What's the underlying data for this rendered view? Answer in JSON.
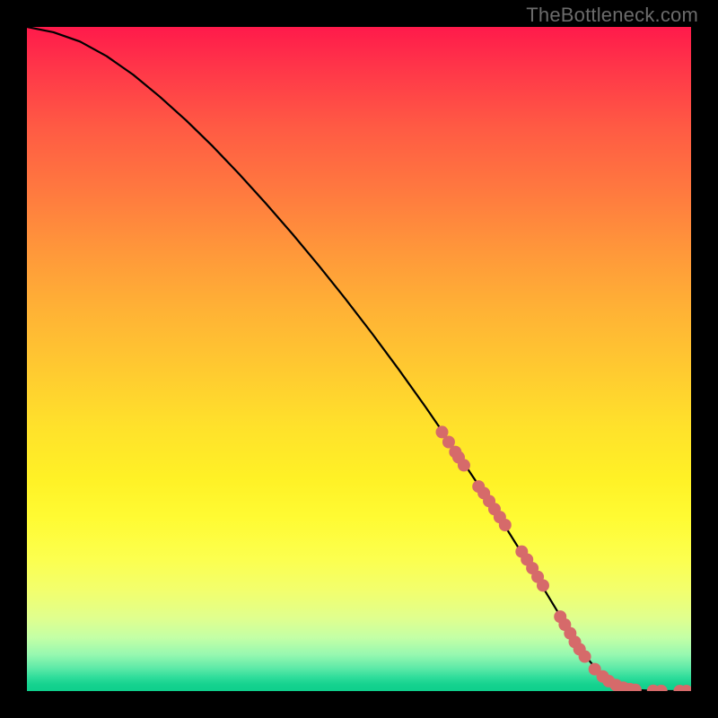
{
  "watermark": "TheBottleneck.com",
  "chart_data": {
    "type": "line",
    "title": "",
    "xlabel": "",
    "ylabel": "",
    "xlim": [
      0,
      100
    ],
    "ylim": [
      0,
      100
    ],
    "grid": false,
    "series": [
      {
        "name": "curve",
        "stroke": "#000000",
        "x": [
          0,
          4,
          8,
          12,
          16,
          20,
          24,
          28,
          32,
          36,
          40,
          44,
          48,
          52,
          56,
          60,
          64,
          68,
          72,
          76,
          80,
          82,
          84,
          86,
          88,
          90,
          92,
          94,
          96,
          98,
          100
        ],
        "y": [
          100,
          99.2,
          97.8,
          95.6,
          92.8,
          89.5,
          85.9,
          82.0,
          77.8,
          73.4,
          68.8,
          64.0,
          59.0,
          53.8,
          48.4,
          42.8,
          37.0,
          31.0,
          24.8,
          18.4,
          11.8,
          8.4,
          5.4,
          3.0,
          1.4,
          0.5,
          0.15,
          0.05,
          0.0,
          0.0,
          0.0
        ]
      }
    ],
    "markers": {
      "color": "#d66a6a",
      "radius_px": 7,
      "points_xy": [
        [
          62.5,
          39.0
        ],
        [
          63.5,
          37.5
        ],
        [
          64.5,
          36.0
        ],
        [
          65.0,
          35.2
        ],
        [
          65.8,
          34.0
        ],
        [
          68.0,
          30.8
        ],
        [
          68.8,
          29.8
        ],
        [
          69.6,
          28.6
        ],
        [
          70.4,
          27.4
        ],
        [
          71.2,
          26.2
        ],
        [
          72.0,
          25.0
        ],
        [
          74.5,
          21.0
        ],
        [
          75.3,
          19.8
        ],
        [
          76.1,
          18.5
        ],
        [
          76.9,
          17.2
        ],
        [
          77.7,
          15.9
        ],
        [
          80.3,
          11.2
        ],
        [
          81.0,
          10.0
        ],
        [
          81.8,
          8.7
        ],
        [
          82.5,
          7.4
        ],
        [
          83.2,
          6.3
        ],
        [
          84.0,
          5.2
        ],
        [
          85.5,
          3.3
        ],
        [
          86.7,
          2.2
        ],
        [
          87.6,
          1.5
        ],
        [
          88.7,
          0.9
        ],
        [
          89.8,
          0.5
        ],
        [
          90.8,
          0.28
        ],
        [
          91.6,
          0.18
        ],
        [
          94.3,
          0.04
        ],
        [
          95.5,
          0.02
        ],
        [
          98.3,
          0.0
        ],
        [
          99.3,
          0.0
        ]
      ]
    },
    "background_gradient": {
      "top": "#ff1a4b",
      "mid": "#ffe12b",
      "bottom": "#0fcf8c"
    }
  }
}
